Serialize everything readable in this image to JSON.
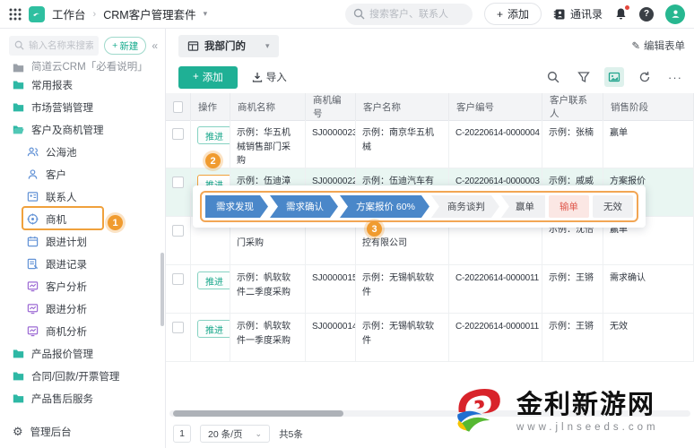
{
  "header": {
    "workspace_label": "工作台",
    "app_title": "CRM客户管理套件",
    "search_placeholder": "搜索客户、联系人",
    "add_label": "添加",
    "contacts_label": "通讯录"
  },
  "sidebar": {
    "search_placeholder": "输入名称来搜索",
    "new_label": "新建",
    "items": [
      {
        "label": "简道云CRM「必看说明」"
      },
      {
        "label": "常用报表"
      },
      {
        "label": "市场营销管理"
      },
      {
        "label": "客户及商机管理"
      },
      {
        "label": "公海池"
      },
      {
        "label": "客户"
      },
      {
        "label": "联系人"
      },
      {
        "label": "商机"
      },
      {
        "label": "跟进计划"
      },
      {
        "label": "跟进记录"
      },
      {
        "label": "客户分析"
      },
      {
        "label": "跟进分析"
      },
      {
        "label": "商机分析"
      },
      {
        "label": "产品报价管理"
      },
      {
        "label": "合同/回款/开票管理"
      },
      {
        "label": "产品售后服务"
      }
    ],
    "admin_label": "管理后台"
  },
  "view_bar": {
    "view_name": "我部门的",
    "edit_form_label": "编辑表单"
  },
  "toolbar": {
    "add_label": "添加",
    "import_label": "导入"
  },
  "table": {
    "columns": [
      "操作",
      "商机名称",
      "商机编号",
      "客户名称",
      "客户编号",
      "客户联系人",
      "销售阶段"
    ],
    "rows": [
      {
        "op": "推进",
        "name": "示例：华五机械销售部门采购",
        "sj": "SJ0000023",
        "customer": "示例：南京华五机械",
        "cno": "C-20220614-0000004",
        "contact": "示例：张楠",
        "stage": "赢单"
      },
      {
        "op": "推进",
        "name": "示例：伍迪漳州门店采购",
        "sj": "SJ0000022",
        "customer": "示例：伍迪汽车有限公司",
        "cno": "C-20220614-0000003",
        "contact": "示例：戚威",
        "stage": "方案报价"
      },
      {
        "op": "",
        "name": "门采购",
        "sj": "",
        "customer": "控有限公司",
        "cno": "",
        "contact": "示例：沈怡",
        "stage": "赢单"
      },
      {
        "op": "推进",
        "name": "示例：帆软软件二季度采购",
        "sj": "SJ0000015",
        "customer": "示例：无锡帆软软件",
        "cno": "C-20220614-0000011",
        "contact": "示例：王锵",
        "stage": "需求确认"
      },
      {
        "op": "推进",
        "name": "示例：帆软软件一季度采购",
        "sj": "SJ0000014",
        "customer": "示例：无锡帆软软件",
        "cno": "C-20220614-0000011",
        "contact": "示例：王锵",
        "stage": "无效"
      }
    ]
  },
  "stage_flow": {
    "steps": [
      {
        "label": "需求发现",
        "state": "done"
      },
      {
        "label": "需求确认",
        "state": "done"
      },
      {
        "label": "方案报价 60%",
        "state": "current"
      },
      {
        "label": "商务谈判",
        "state": "todo"
      },
      {
        "label": "赢单",
        "state": "todo"
      },
      {
        "label": "输单",
        "state": "lost"
      },
      {
        "label": "无效",
        "state": "todo"
      }
    ]
  },
  "annotations": {
    "step1": "1",
    "step2": "2",
    "step3": "3"
  },
  "pagination": {
    "page": "1",
    "page_size": "20 条/页",
    "total": "共5条"
  },
  "watermark": {
    "site_name": "金利新游网",
    "site_url": "www.jlnseeds.com"
  },
  "icons": {
    "plus": "+",
    "breadcrumb_sep": "›",
    "chevron_down": "▾",
    "select_caret": "⌄",
    "collapse": "«",
    "edit_pencil": "✎",
    "gear": "⚙",
    "help": "?",
    "more": "···"
  },
  "colors": {
    "accent_teal": "#1fb095",
    "stage_blue": "#4a87c9",
    "annotation_orange": "#f09b2f",
    "lost_red": "#df574b",
    "row_highlight": "#e9f6f2"
  }
}
